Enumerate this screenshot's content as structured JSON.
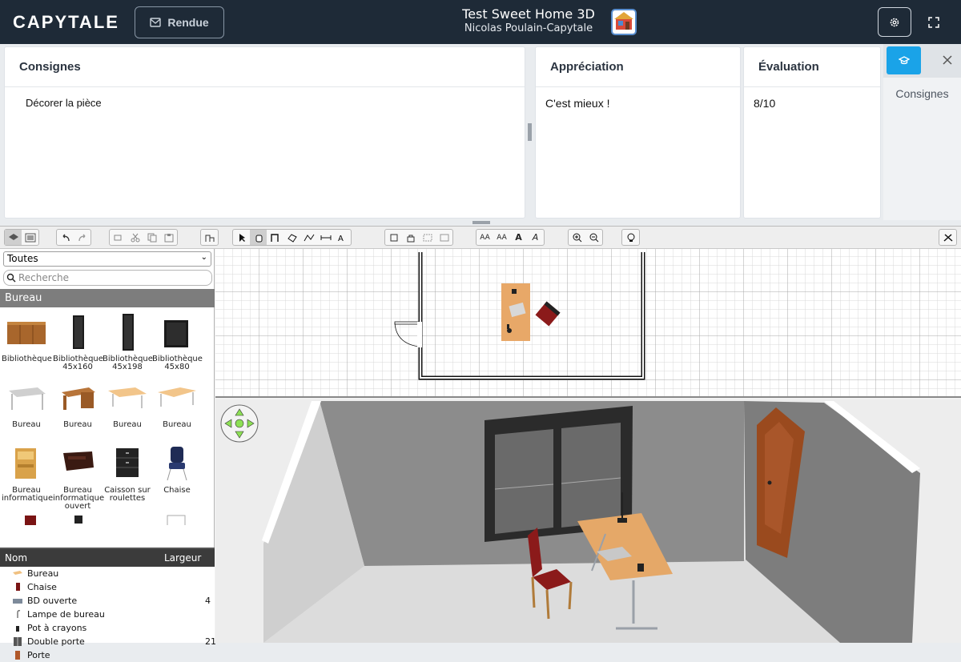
{
  "header": {
    "brand": "CAPYTALE",
    "rendue_label": "Rendue",
    "title": "Test Sweet Home 3D",
    "subtitle": "Nicolas Poulain-Capytale"
  },
  "panels": {
    "consignes": {
      "title": "Consignes",
      "text": "Décorer la pièce"
    },
    "appreciation": {
      "title": "Appréciation",
      "text": "C'est mieux !"
    },
    "evaluation": {
      "title": "Évaluation",
      "text": "8/10"
    },
    "side_label": "Consignes"
  },
  "catalog": {
    "category_select": "Toutes",
    "search_placeholder": "Recherche",
    "category": "Bureau",
    "items": [
      {
        "line1": "Bibliothèque",
        "line2": "",
        "line3": ""
      },
      {
        "line1": "Bibliothèque",
        "line2": "45x160",
        "line3": ""
      },
      {
        "line1": "Bibliothèque",
        "line2": "45x198",
        "line3": ""
      },
      {
        "line1": "Bibliothèque",
        "line2": "45x80",
        "line3": ""
      },
      {
        "line1": "Bureau",
        "line2": "",
        "line3": ""
      },
      {
        "line1": "Bureau",
        "line2": "",
        "line3": ""
      },
      {
        "line1": "Bureau",
        "line2": "",
        "line3": ""
      },
      {
        "line1": "Bureau",
        "line2": "",
        "line3": ""
      },
      {
        "line1": "Bureau",
        "line2": "informatique",
        "line3": ""
      },
      {
        "line1": "Bureau",
        "line2": "informatique",
        "line3": "ouvert"
      },
      {
        "line1": "Caisson sur",
        "line2": "roulettes",
        "line3": ""
      },
      {
        "line1": "Chaise",
        "line2": "",
        "line3": ""
      }
    ]
  },
  "furniture_list": {
    "col_name": "Nom",
    "col_width": "Largeur",
    "rows": [
      {
        "name": "Bureau",
        "width": ""
      },
      {
        "name": "Chaise",
        "width": ""
      },
      {
        "name": "BD ouverte",
        "width": "4"
      },
      {
        "name": "Lampe de bureau",
        "width": ""
      },
      {
        "name": "Pot à crayons",
        "width": ""
      },
      {
        "name": "Double porte",
        "width": "21"
      },
      {
        "name": "Porte",
        "width": ""
      }
    ]
  },
  "toolbar": {
    "text_buttons": [
      "AA",
      "AA",
      "A",
      "A"
    ]
  },
  "colors": {
    "header_bg": "#1e2a37",
    "accent": "#1aa3e8",
    "category_bar": "#7d7d7d"
  }
}
